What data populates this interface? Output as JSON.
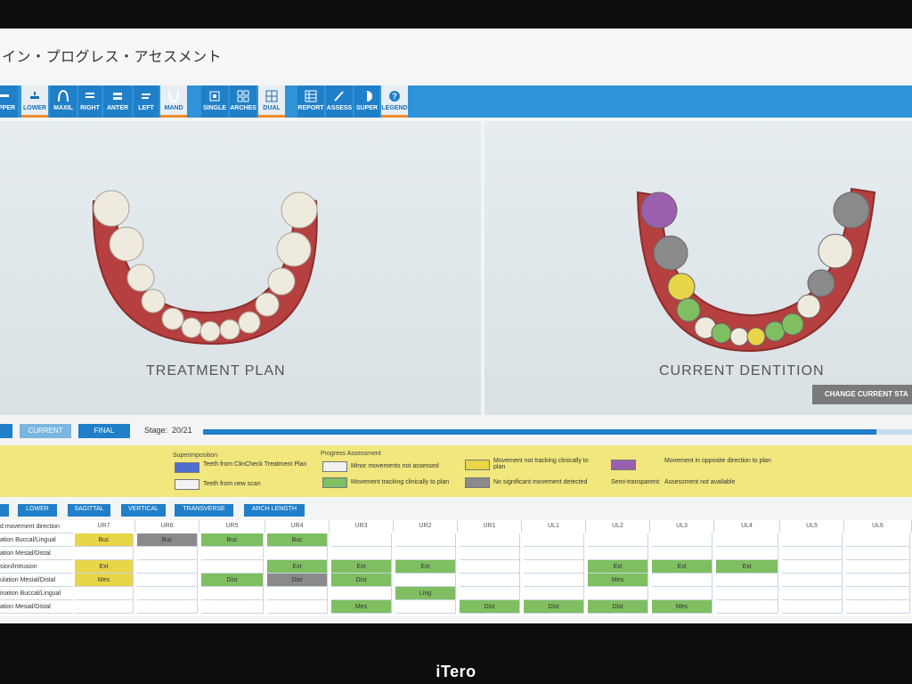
{
  "app": {
    "title": "イン・プログレス・アセスメント"
  },
  "toolbar": [
    {
      "label": "UPPER",
      "icon": "upper-jaw-icon",
      "active": false
    },
    {
      "label": "LOWER",
      "icon": "lower-jaw-icon",
      "active": true
    },
    {
      "label": "MAXIL",
      "icon": "maxillary-arch-icon",
      "active": false
    },
    {
      "label": "RIGHT",
      "icon": "right-view-icon",
      "active": false
    },
    {
      "label": "ANTER",
      "icon": "anterior-view-icon",
      "active": false
    },
    {
      "label": "LEFT",
      "icon": "left-view-icon",
      "active": false
    },
    {
      "label": "MAND",
      "icon": "mandibular-arch-icon",
      "active": true
    },
    {
      "label": "SINGLE",
      "icon": "single-view-icon",
      "active": false
    },
    {
      "label": "ARCHES",
      "icon": "arches-grid-icon",
      "active": false
    },
    {
      "label": "DUAL",
      "icon": "dual-view-icon",
      "active": true
    },
    {
      "label": "REPORT",
      "icon": "report-table-icon",
      "active": false
    },
    {
      "label": "ASSESS",
      "icon": "assess-pen-icon",
      "active": false
    },
    {
      "label": "SUPER",
      "icon": "superimpose-icon",
      "active": false
    },
    {
      "label": "LEGEND",
      "icon": "help-icon",
      "active": true
    }
  ],
  "viewer": {
    "left_label": "TREATMENT PLAN",
    "right_label": "CURRENT DENTITION",
    "change_stage": "CHANGE CURRENT STA"
  },
  "stage": {
    "buttons": [
      "",
      "CURRENT",
      "FINAL"
    ],
    "label": "Stage:",
    "value": "20/21",
    "progress": 0.95
  },
  "legend": {
    "superimposition_title": "Superimposition",
    "superimposition": [
      {
        "color": "#4f6fd0",
        "text": "Teeth from ClinCheck Treatment Plan"
      },
      {
        "color": "#f3f3f3",
        "text": "Teeth from new scan"
      }
    ],
    "progress_title": "Progress Assessment",
    "progress": [
      {
        "color": "#f1f1f1",
        "text": "Minor movements not assessed"
      },
      {
        "color": "#7fbe61",
        "text": "Movement tracking clinically to plan"
      },
      {
        "color": "#e9d548",
        "text": "Movement not tracking clinically to plan"
      },
      {
        "color": "#8a8a8a",
        "text": "No significant movement detected"
      },
      {
        "color": "#9b5fb0",
        "text": "Movement in opposite direction to plan"
      }
    ],
    "semi_label": "Semi-transparent:",
    "semi_text": "Assessment not available"
  },
  "tabs": [
    "",
    "LOWER",
    "SAGITTAL",
    "VERTICAL",
    "TRANSVERSE",
    "ARCH LENGTH"
  ],
  "table": {
    "columns": [
      "d movement direction",
      "UR7",
      "UR6",
      "UR5",
      "UR4",
      "UR3",
      "UR2",
      "UR1",
      "UL1",
      "UL2",
      "UL3",
      "UL4",
      "UL5",
      "UL6"
    ],
    "rows": [
      {
        "label": "ation Buccal/Lingual",
        "cells": [
          [
            "Buc",
            "yellow"
          ],
          [
            "Buc",
            "gray"
          ],
          [
            "Buc",
            "green"
          ],
          [
            "Buc",
            "green"
          ],
          [
            "",
            ""
          ],
          [
            "",
            ""
          ],
          [
            "",
            ""
          ],
          [
            "",
            ""
          ],
          [
            "",
            ""
          ],
          [
            "",
            ""
          ],
          [
            "",
            ""
          ],
          [
            "",
            ""
          ],
          [
            "",
            ""
          ]
        ]
      },
      {
        "label": "ation Mesial/Distal",
        "cells": [
          [
            "",
            ""
          ],
          [
            "",
            ""
          ],
          [
            "",
            ""
          ],
          [
            "",
            ""
          ],
          [
            "",
            ""
          ],
          [
            "",
            ""
          ],
          [
            "",
            ""
          ],
          [
            "",
            ""
          ],
          [
            "",
            ""
          ],
          [
            "",
            ""
          ],
          [
            "",
            ""
          ],
          [
            "",
            ""
          ],
          [
            "",
            ""
          ]
        ]
      },
      {
        "label": "sion/Intrusion",
        "cells": [
          [
            "Ext",
            "yellow"
          ],
          [
            "",
            ""
          ],
          [
            "",
            ""
          ],
          [
            "Ext",
            "green"
          ],
          [
            "Ext",
            "green"
          ],
          [
            "Ext",
            "green"
          ],
          [
            "",
            ""
          ],
          [
            "",
            ""
          ],
          [
            "Ext",
            "green"
          ],
          [
            "Ext",
            "green"
          ],
          [
            "Ext",
            "green"
          ],
          [
            "",
            ""
          ],
          [
            "",
            ""
          ]
        ]
      },
      {
        "label": "ulation Mesial/Distal",
        "cells": [
          [
            "Mes",
            "yellow"
          ],
          [
            "",
            ""
          ],
          [
            "Dist",
            "green"
          ],
          [
            "Dist",
            "gray"
          ],
          [
            "Dist",
            "green"
          ],
          [
            "",
            ""
          ],
          [
            "",
            ""
          ],
          [
            "",
            ""
          ],
          [
            "Mes",
            "green"
          ],
          [
            "",
            ""
          ],
          [
            "",
            ""
          ],
          [
            "",
            ""
          ],
          [
            "",
            ""
          ]
        ]
      },
      {
        "label": "ination Buccal/Lingual",
        "cells": [
          [
            "",
            ""
          ],
          [
            "",
            ""
          ],
          [
            "",
            ""
          ],
          [
            "",
            ""
          ],
          [
            "",
            ""
          ],
          [
            "Ling",
            "green"
          ],
          [
            "",
            ""
          ],
          [
            "",
            ""
          ],
          [
            "",
            ""
          ],
          [
            "",
            ""
          ],
          [
            "",
            ""
          ],
          [
            "",
            ""
          ],
          [
            "",
            ""
          ]
        ]
      },
      {
        "label": "ation Mesial/Distal",
        "cells": [
          [
            "",
            ""
          ],
          [
            "",
            ""
          ],
          [
            "",
            ""
          ],
          [
            "",
            ""
          ],
          [
            "Mes",
            "green"
          ],
          [
            "",
            ""
          ],
          [
            "Dist",
            "green"
          ],
          [
            "Dist",
            "green"
          ],
          [
            "Dist",
            "green"
          ],
          [
            "Mes",
            "green"
          ],
          [
            "",
            ""
          ],
          [
            "",
            ""
          ],
          [
            "",
            ""
          ]
        ]
      }
    ]
  },
  "device": {
    "logo": "iTero"
  }
}
